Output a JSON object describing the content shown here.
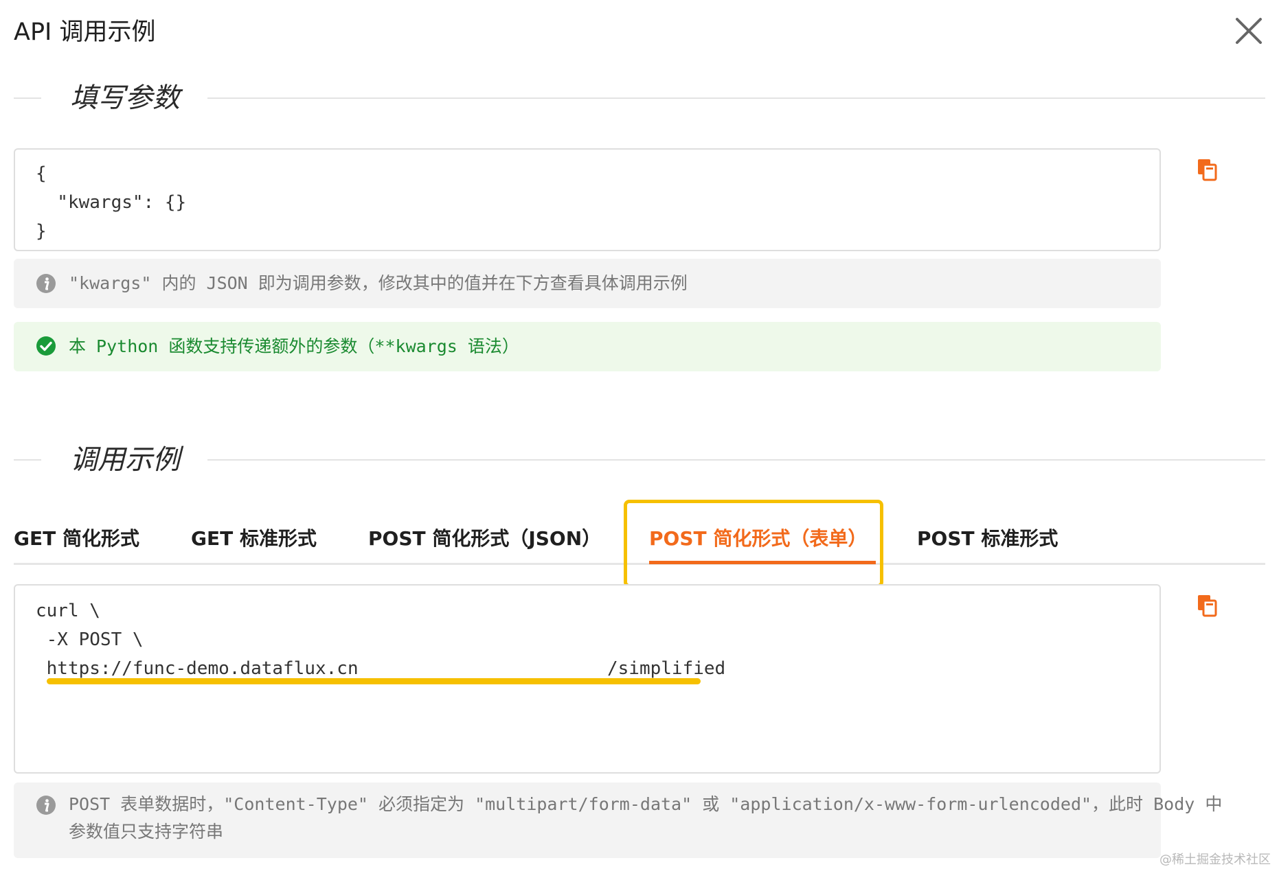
{
  "dialog": {
    "title": "API 调用示例",
    "close_icon": "close-icon"
  },
  "params_section": {
    "title": "填写参数",
    "code_lines": [
      "{",
      "  \"kwargs\": {}",
      "}"
    ],
    "copy_icon": "copy-icon",
    "info_alert": {
      "icon": "info-icon",
      "text": "\"kwargs\" 内的 JSON 即为调用参数，修改其中的值并在下方查看具体调用示例"
    },
    "success_alert": {
      "icon": "check-circle-icon",
      "text": "本 Python 函数支持传递额外的参数（**kwargs 语法）"
    }
  },
  "example_section": {
    "title": "调用示例",
    "tabs": [
      {
        "label": "GET 简化形式",
        "active": false
      },
      {
        "label": "GET 标准形式",
        "active": false
      },
      {
        "label": "POST 简化形式（JSON）",
        "active": false
      },
      {
        "label": "POST 简化形式（表单）",
        "active": true
      },
      {
        "label": "POST 标准形式",
        "active": false
      }
    ],
    "code_lines": [
      "curl \\",
      " -X POST \\",
      " https://func-demo.dataflux.cn",
      "/simplified"
    ],
    "copy_icon": "copy-icon",
    "info_alert": {
      "icon": "info-icon",
      "line1": "POST 表单数据时，\"Content-Type\" 必须指定为 \"multipart/form-data\" 或 \"application/x-www-form-urlencoded\"，此时 Body 中",
      "line2": "参数值只支持字符串"
    }
  },
  "colors": {
    "accent": "#f26a1b",
    "highlight": "#f6c000",
    "success": "#1a9b3a",
    "info_bg": "#f3f3f3",
    "success_bg": "#eef9ea"
  },
  "watermark": "@稀土掘金技术社区"
}
